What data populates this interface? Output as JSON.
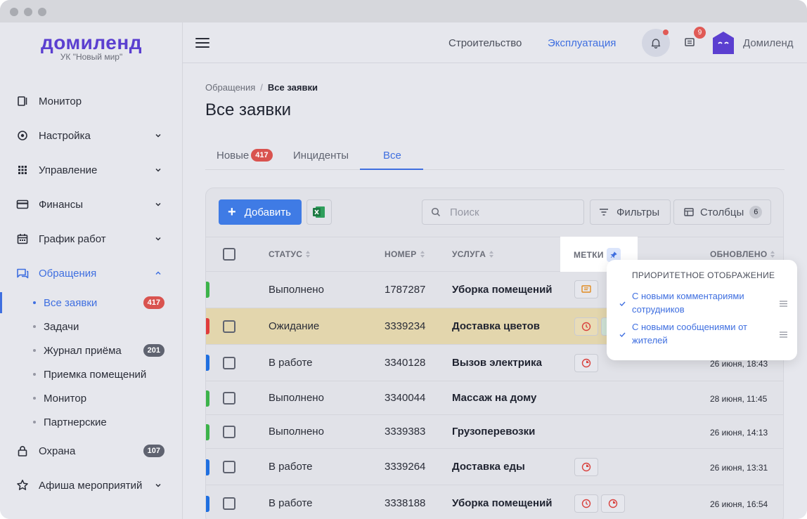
{
  "app": {
    "logo": "домиленд",
    "company": "УК \"Новый мир\""
  },
  "sidebar": {
    "items": [
      {
        "label": "Монитор",
        "icon": "monitor-icon"
      },
      {
        "label": "Настройка",
        "icon": "settings-icon"
      },
      {
        "label": "Управление",
        "icon": "grid-icon"
      },
      {
        "label": "Финансы",
        "icon": "card-icon"
      },
      {
        "label": "График работ",
        "icon": "calendar-icon"
      },
      {
        "label": "Обращения",
        "icon": "chat-icon"
      },
      {
        "label": "Охрана",
        "icon": "lock-icon",
        "count": "107"
      },
      {
        "label": "Афиша мероприятий",
        "icon": "star-icon"
      }
    ],
    "sub": [
      {
        "label": "Все заявки",
        "count": "417"
      },
      {
        "label": "Задачи"
      },
      {
        "label": "Журнал приёма",
        "count": "201"
      },
      {
        "label": "Приемка помещений"
      },
      {
        "label": "Монитор"
      },
      {
        "label": "Партнерские"
      }
    ]
  },
  "header": {
    "link1": "Строительство",
    "link2": "Эксплуатация",
    "msg_count": "9",
    "user": "Домиленд"
  },
  "page": {
    "breadcrumb_root": "Обращения",
    "breadcrumb_current": "Все заявки",
    "title": "Все заявки",
    "tabs": [
      {
        "label": "Новые",
        "count": "417"
      },
      {
        "label": "Инциденты"
      },
      {
        "label": "Все"
      }
    ]
  },
  "toolbar": {
    "add_label": "Добавить",
    "search_placeholder": "Поиск",
    "filter_label": "Фильтры",
    "columns_label": "Столбцы",
    "columns_count": "6"
  },
  "table": {
    "headers": {
      "status": "СТАТУС",
      "number": "НОМЕР",
      "service": "УСЛУГА",
      "tags": "МЕТКИ",
      "updated": "ОБНОВЛЕНО"
    },
    "rows": [
      {
        "status": "Выполнено",
        "number": "1787287",
        "service": "Уборка помещений",
        "updated": "",
        "color": "#3cb34a"
      },
      {
        "status": "Ожидание",
        "number": "3339234",
        "service": "Доставка цветов",
        "updated": "",
        "color": "#e03c3c"
      },
      {
        "status": "В работе",
        "number": "3340128",
        "service": "Вызов электрика",
        "updated": "26 июня, 18:43",
        "color": "#1f6fe0"
      },
      {
        "status": "Выполнено",
        "number": "3340044",
        "service": "Массаж на дому",
        "updated": "28 июня, 11:45",
        "color": "#3cb34a"
      },
      {
        "status": "Выполнено",
        "number": "3339383",
        "service": "Грузоперевозки",
        "updated": "26 июня, 14:13",
        "color": "#3cb34a"
      },
      {
        "status": "В работе",
        "number": "3339264",
        "service": "Доставка еды",
        "updated": "26 июня, 13:31",
        "color": "#1f6fe0"
      },
      {
        "status": "В работе",
        "number": "3338188",
        "service": "Уборка помещений",
        "updated": "26 июня, 16:54",
        "color": "#1f6fe0"
      }
    ]
  },
  "popup": {
    "title": "ПРИОРИТЕТНОЕ ОТОБРАЖЕНИЕ",
    "items": [
      "С новыми комментариями сотрудников",
      "С новыми сообщениями от жителей"
    ]
  }
}
